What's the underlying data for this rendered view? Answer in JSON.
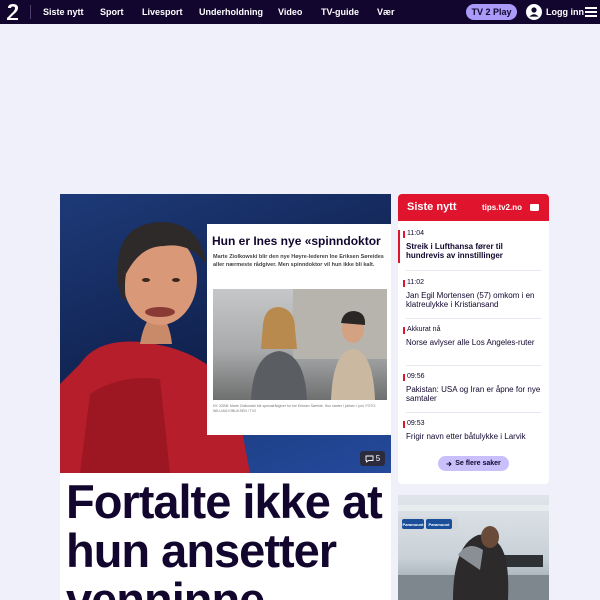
{
  "nav": {
    "items": [
      "Siste nytt",
      "Sport",
      "Livesport",
      "Underholdning",
      "Video",
      "TV-guide",
      "Vær"
    ],
    "tv2play": "TV 2 Play",
    "login": "Logg inn"
  },
  "hero": {
    "title": "Fortalte ikke at hun ansetter venninne",
    "comments": "5",
    "inset": {
      "headline": "Hun er Ines nye «spinndoktor",
      "body": "Marte Ziolkowski blir den nye Høyre-lederen Ine Eriksen Søreides aller nærmeste rådgiver. Men spinndoktor vil hun ikke bli kalt.",
      "caption": "NY JOBB: Marte Ziolkowski blir spesialrådgiver for Ine Eriksen Søreide. Hun starter i jobben i juni. FOTO: WILLIAM IOBLIKSEN / TV2"
    }
  },
  "sidebar": {
    "title": "Siste nytt",
    "tips": "tips.tv2.no",
    "items": [
      {
        "time": "11:04",
        "text": "Streik i Lufthansa fører til hundrevis av innstillinger"
      },
      {
        "time": "11:02",
        "text": "Jan Egil Mortensen (57) omkom i en klatreulykke i Kristiansand"
      },
      {
        "time": "Akkurat nå",
        "text": "Norse avlyser alle Los Angeles-ruter"
      },
      {
        "time": "09:56",
        "text": "Pakistan: USA og Iran er åpne for nye samtaler"
      },
      {
        "time": "09:53",
        "text": "Frigir navn etter båtulykke i Larvik"
      }
    ],
    "more": "Se flere saker"
  },
  "side_image": {
    "sign": "Paramount"
  },
  "colors": {
    "topbar": "#12062e",
    "accent_red": "#e0142d",
    "play_purple": "#a99bf7",
    "background": "#f0f0fa"
  }
}
